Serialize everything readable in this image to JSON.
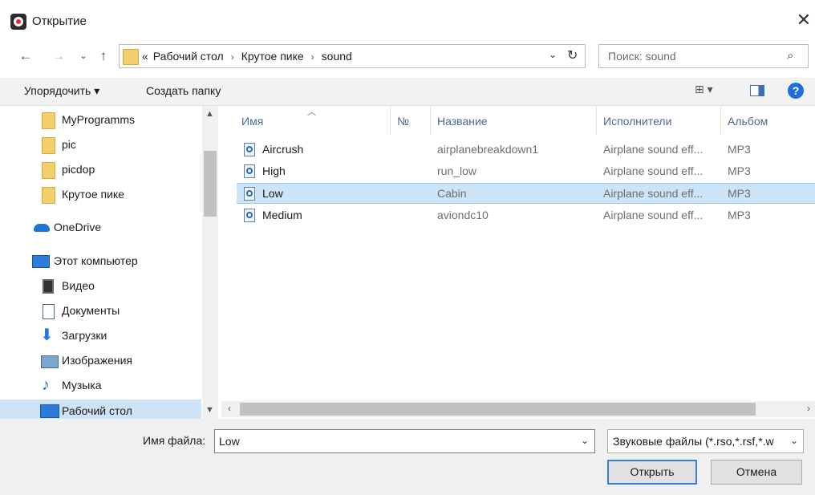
{
  "window": {
    "title": "Открытие",
    "close_glyph": "✕"
  },
  "address": {
    "crumb_prefix": "«",
    "crumbs": [
      "Рабочий стол",
      "Крутое пике",
      "sound"
    ],
    "search_placeholder": "Поиск: sound"
  },
  "toolbar": {
    "organize_label": "Упорядочить ▾",
    "new_folder_label": "Создать папку",
    "view_label": "⊞ ▾",
    "help_label": "?"
  },
  "nav": {
    "items": [
      {
        "label": "MyProgramms",
        "icon": "folder-icon"
      },
      {
        "label": "pic",
        "icon": "folder-icon"
      },
      {
        "label": "picdop",
        "icon": "folder-icon"
      },
      {
        "label": "Крутое пике",
        "icon": "folder-icon"
      },
      {
        "label": "OneDrive",
        "icon": "onedrive-icon"
      },
      {
        "label": "Этот компьютер",
        "icon": "computer-icon"
      },
      {
        "label": "Видео",
        "icon": "video-icon"
      },
      {
        "label": "Документы",
        "icon": "documents-icon"
      },
      {
        "label": "Загрузки",
        "icon": "downloads-icon"
      },
      {
        "label": "Изображения",
        "icon": "pictures-icon"
      },
      {
        "label": "Музыка",
        "icon": "music-icon"
      },
      {
        "label": "Рабочий стол",
        "icon": "desktop-icon",
        "selected": true
      }
    ]
  },
  "list": {
    "columns": [
      "Имя",
      "№",
      "Название",
      "Исполнители",
      "Альбом"
    ],
    "rows": [
      {
        "name": "Aircrush",
        "number": "",
        "title": "airplanebreakdown1",
        "artist": "Airplane sound eff...",
        "album": "MP3"
      },
      {
        "name": "High",
        "number": "",
        "title": "run_low",
        "artist": "Airplane sound eff...",
        "album": "MP3"
      },
      {
        "name": "Low",
        "number": "",
        "title": "Cabin",
        "artist": "Airplane sound eff...",
        "album": "MP3",
        "selected": true
      },
      {
        "name": "Medium",
        "number": "",
        "title": "aviondc10",
        "artist": "Airplane sound eff...",
        "album": "MP3"
      }
    ]
  },
  "footer": {
    "file_name_label": "Имя файла:",
    "file_name_value": "Low",
    "file_type_value": "Звуковые файлы (*.rso,*.rsf,*.w",
    "open_label": "Открыть",
    "cancel_label": "Отмена"
  },
  "colors": {
    "selection": "#cce4f7",
    "accent": "#1e6fd9",
    "header_text": "#4a6a8a"
  }
}
